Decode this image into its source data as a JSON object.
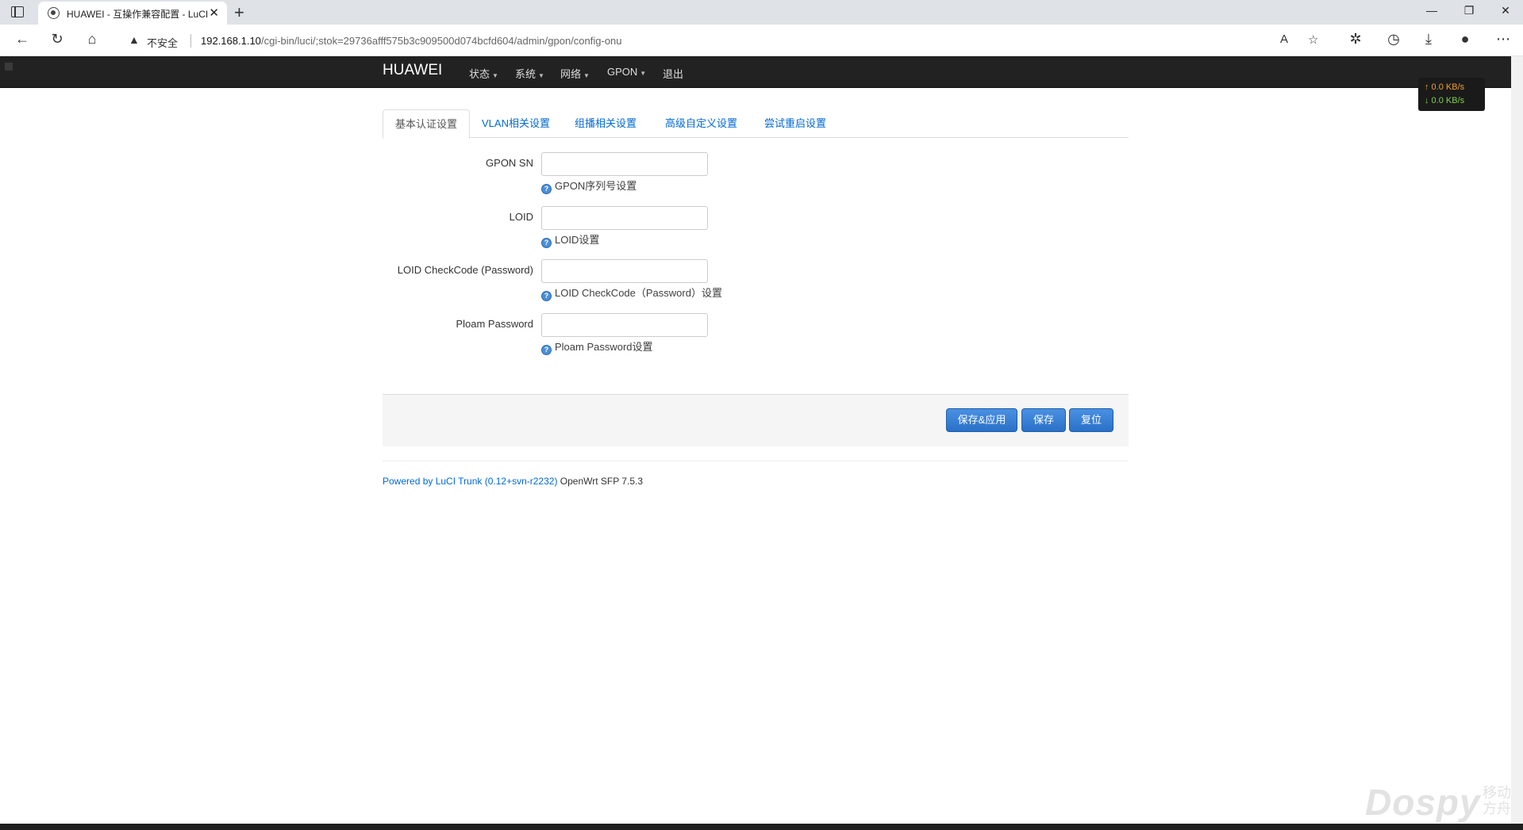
{
  "browser": {
    "tab_title": "HUAWEI - 互操作兼容配置 - LuCI",
    "tab_close": "✕",
    "new_tab": "+",
    "insecure_label": "不安全",
    "url_host": "192.168.1.10",
    "url_path": "/cgi-bin/luci/;stok=29736afff575b3c909500d074bcfd604/admin/gpon/config-onu"
  },
  "navbar": {
    "brand": "HUAWEI",
    "items": [
      {
        "label": "状态"
      },
      {
        "label": "系统"
      },
      {
        "label": "网络"
      },
      {
        "label": "GPON"
      },
      {
        "label": "退出"
      }
    ]
  },
  "speed": {
    "up": "↑ 0.0 KB/s",
    "down": "↓ 0.0 KB/s"
  },
  "tabs": [
    {
      "label": "基本认证设置"
    },
    {
      "label": "VLAN相关设置"
    },
    {
      "label": "组播相关设置"
    },
    {
      "label": "高级自定义设置"
    },
    {
      "label": "尝试重启设置"
    }
  ],
  "form": {
    "fields": [
      {
        "label": "GPON SN",
        "value": "",
        "help": "GPON序列号设置"
      },
      {
        "label": "LOID",
        "value": "",
        "help": "LOID设置"
      },
      {
        "label": "LOID CheckCode (Password)",
        "value": "",
        "help": "LOID CheckCode（Password）设置"
      },
      {
        "label": "Ploam Password",
        "value": "",
        "help": "Ploam Password设置"
      }
    ]
  },
  "actions": {
    "save_apply": "保存&应用",
    "save": "保存",
    "reset": "复位"
  },
  "footer": {
    "powered": "Powered by LuCI Trunk (0.12+svn-r2232)",
    "version": "OpenWrt SFP 7.5.3"
  },
  "watermark": {
    "text": "Dospy",
    "cn": "移动方舟"
  },
  "colors": {
    "navbar_bg": "#222222",
    "link": "#0069d6",
    "button": "#2a70c8"
  }
}
